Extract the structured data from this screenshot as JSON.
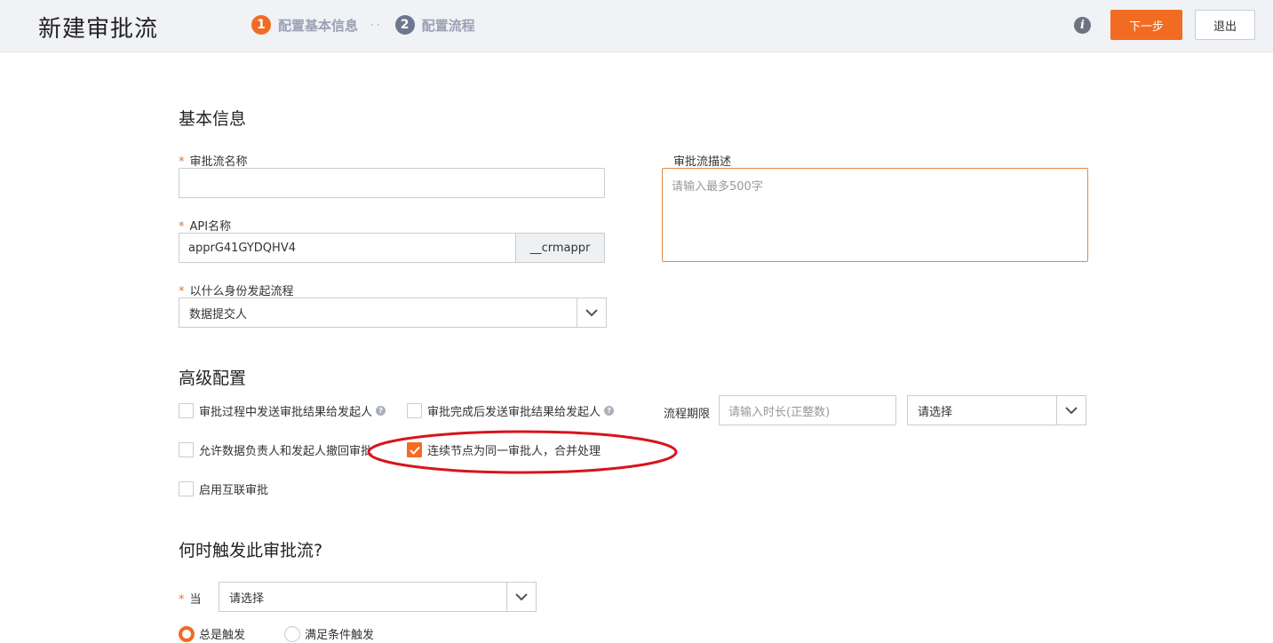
{
  "header": {
    "title": "新建审批流",
    "steps": [
      {
        "num": "1",
        "label": "配置基本信息"
      },
      {
        "num": "2",
        "label": "配置流程"
      }
    ],
    "step_separator": "··",
    "info_icon": "i",
    "next_label": "下一步",
    "exit_label": "退出"
  },
  "basic": {
    "section_title": "基本信息",
    "name_label": "审批流名称",
    "name_value": "",
    "api_label": "API名称",
    "api_value": "apprG41GYDQHV4",
    "api_suffix": "__crmappr",
    "identity_label": "以什么身份发起流程",
    "identity_value": "数据提交人",
    "desc_label": "审批流描述",
    "desc_placeholder": "请输入最多500字",
    "required_mark": "*"
  },
  "advanced": {
    "section_title": "高级配置",
    "options": [
      {
        "label": "审批过程中发送审批结果给发起人",
        "checked": false,
        "help": true
      },
      {
        "label": "审批完成后发送审批结果给发起人",
        "checked": false,
        "help": true
      },
      {
        "label": "允许数据负责人和发起人撤回审批",
        "checked": false,
        "help": false
      },
      {
        "label": "连续节点为同一审批人，合并处理",
        "checked": true,
        "help": false
      },
      {
        "label": "启用互联审批",
        "checked": false,
        "help": false
      }
    ],
    "period_label": "流程期限",
    "period_placeholder": "请输入时长(正整数)",
    "period_unit_value": "请选择",
    "help_glyph": "?"
  },
  "trigger": {
    "section_title": "何时触发此审批流?",
    "when_label": "当",
    "when_value": "请选择",
    "radios": [
      {
        "label": "总是触发",
        "checked": true
      },
      {
        "label": "满足条件触发",
        "checked": false
      }
    ]
  },
  "colors": {
    "accent": "#f26b22",
    "annotation": "#d8141b"
  }
}
